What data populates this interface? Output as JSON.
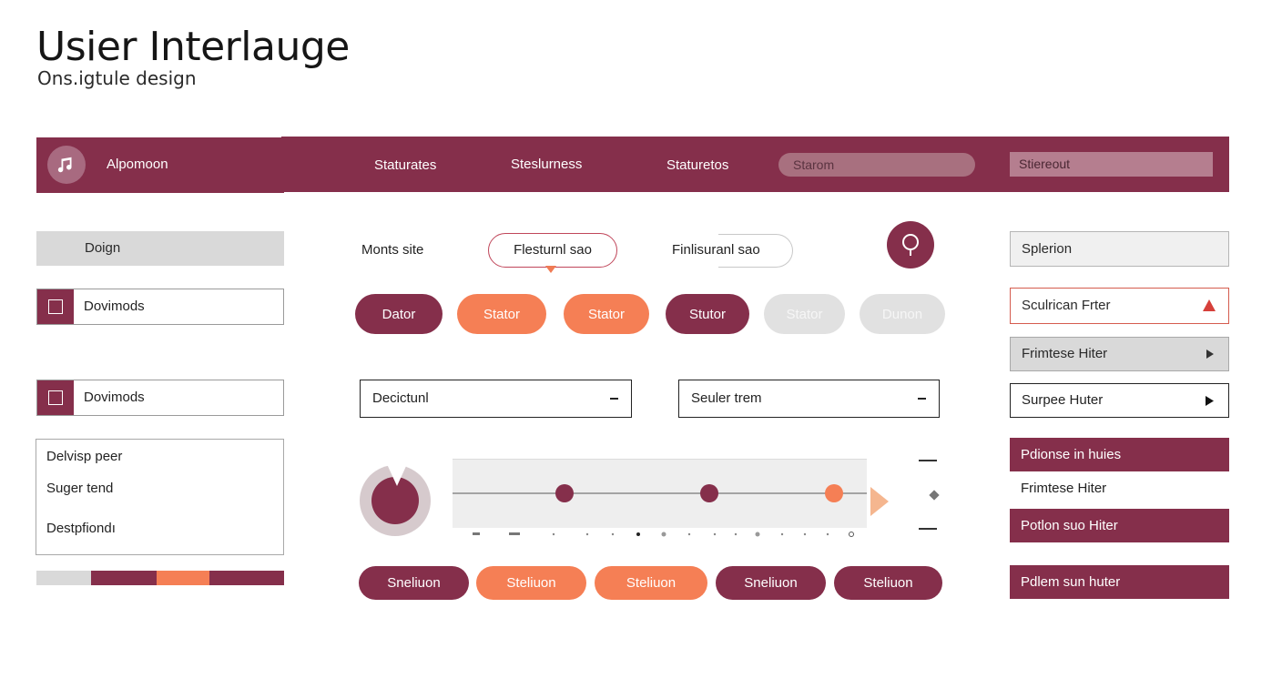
{
  "header": {
    "title": "Usier Interlauge",
    "subtitle": "Ons.igtule design"
  },
  "navbar": {
    "brand": "Alpomoon",
    "links": [
      "Staturates",
      "Steslurness",
      "Staturetos"
    ],
    "search_placeholder": "Starom",
    "searchbox_value": "Stiereout",
    "avatar_icon": "music-note-icon"
  },
  "left_column": {
    "design_label": "Doign",
    "row1_label": "Dovimods",
    "row2_label": "Dovimods",
    "list_items": [
      "Delvisp peer",
      "Suger tend",
      "Destpfiondı"
    ],
    "segmented_bar_colors": [
      "#d9d9d9",
      "#852f4b",
      "#f57f55",
      "#852f4b"
    ]
  },
  "center": {
    "plain_label": "Monts site",
    "tooltip_pill": "Flesturnl sao",
    "half_pill": "Finlisuranl sao",
    "buttons_row1": [
      "Dator",
      "Stator",
      "Stator",
      "Stutor",
      "Stator",
      "Dunon"
    ],
    "dropdown1": "Decictunl",
    "dropdown2": "Seuler trem",
    "slider_values": [
      0.27,
      0.62,
      0.92
    ],
    "buttons_row2": [
      "Sneliuon",
      "Steliuon",
      "Steliuon",
      "Sneliuon",
      "Steliuon"
    ]
  },
  "right_column": {
    "items": [
      "Splerion",
      "Sculrican Frter",
      "Frimtese Hiter",
      "Surpee Huter",
      "Pdionse in huies",
      "Frimtese Hiter",
      "Potlon suo Hiter",
      "Pdlem sun huter"
    ]
  },
  "colors": {
    "maroon": "#852f4b",
    "orange": "#f57f55",
    "light_gray": "#d9d9d9",
    "warning_red": "#d6403a"
  }
}
